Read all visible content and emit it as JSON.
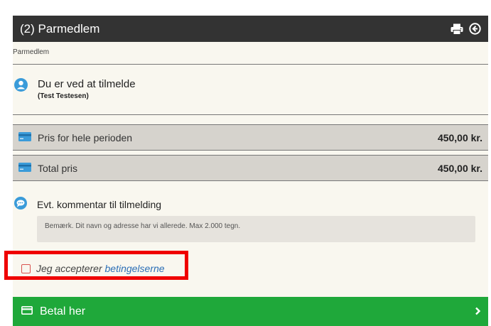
{
  "header": {
    "title": "(2) Parmedlem",
    "print_icon": "print-icon",
    "back_icon": "arrow-circle-left-icon"
  },
  "breadcrumb": "Parmedlem",
  "registrant": {
    "line1": "Du er ved at tilmelde",
    "line2": "(Test Testesen)",
    "icon": "user-circle-icon"
  },
  "prices": [
    {
      "label": "Pris for hele perioden",
      "value": "450,00 kr.",
      "icon": "credit-card-icon"
    },
    {
      "label": "Total pris",
      "value": "450,00 kr.",
      "icon": "credit-card-icon"
    }
  ],
  "comment": {
    "label": "Evt. kommentar til tilmelding",
    "placeholder": "Bemærk. Dit navn og adresse har vi allerede. Max 2.000 tegn.",
    "icon": "chat-bubble-icon"
  },
  "terms": {
    "prefix": "Jeg accepterer",
    "link": "betingelserne"
  },
  "pay": {
    "label": "Betal her",
    "icon": "credit-card-icon",
    "chevron": "chevron-right-icon"
  },
  "colors": {
    "header_bg": "#333333",
    "panel_bg": "#f9f7ef",
    "price_row_bg": "#d6d3cd",
    "accent_blue": "#3a9bd9",
    "pay_green": "#1fa83a",
    "highlight_red": "#ef0000"
  }
}
